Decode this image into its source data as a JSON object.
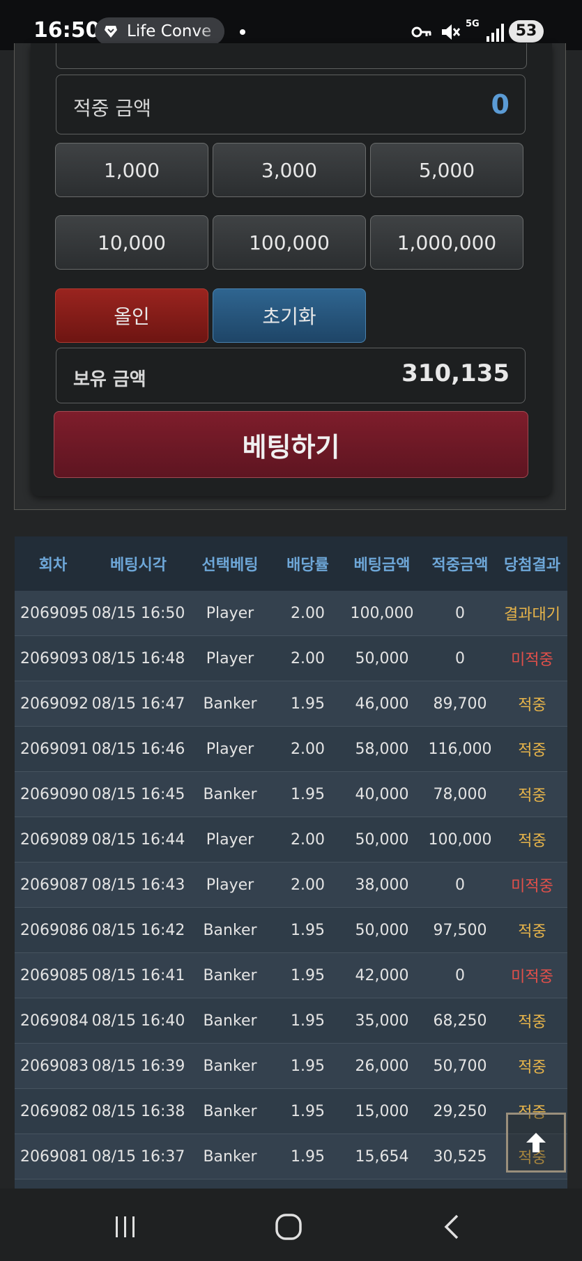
{
  "status_bar": {
    "time": "16:50",
    "app_pill": "Life Conve",
    "network": "5G",
    "battery": "53"
  },
  "bet_panel": {
    "win_amount_label": "적중 금액",
    "win_amount_value": "0",
    "chips": [
      "1,000",
      "3,000",
      "5,000",
      "10,000",
      "100,000",
      "1,000,000"
    ],
    "all_in_label": "올인",
    "reset_label": "초기화",
    "balance_label": "보유 금액",
    "balance_value": "310,135",
    "bet_button_label": "베팅하기"
  },
  "history": {
    "columns": [
      "회차",
      "베팅시각",
      "선택베팅",
      "배당률",
      "베팅금액",
      "적중금액",
      "당첨결과"
    ],
    "rows": [
      [
        "2069095",
        "08/15 16:50",
        "Player",
        "2.00",
        "100,000",
        "0",
        "결과대기"
      ],
      [
        "2069093",
        "08/15 16:48",
        "Player",
        "2.00",
        "50,000",
        "0",
        "미적중"
      ],
      [
        "2069092",
        "08/15 16:47",
        "Banker",
        "1.95",
        "46,000",
        "89,700",
        "적중"
      ],
      [
        "2069091",
        "08/15 16:46",
        "Player",
        "2.00",
        "58,000",
        "116,000",
        "적중"
      ],
      [
        "2069090",
        "08/15 16:45",
        "Banker",
        "1.95",
        "40,000",
        "78,000",
        "적중"
      ],
      [
        "2069089",
        "08/15 16:44",
        "Player",
        "2.00",
        "50,000",
        "100,000",
        "적중"
      ],
      [
        "2069087",
        "08/15 16:43",
        "Player",
        "2.00",
        "38,000",
        "0",
        "미적중"
      ],
      [
        "2069086",
        "08/15 16:42",
        "Banker",
        "1.95",
        "50,000",
        "97,500",
        "적중"
      ],
      [
        "2069085",
        "08/15 16:41",
        "Banker",
        "1.95",
        "42,000",
        "0",
        "미적중"
      ],
      [
        "2069084",
        "08/15 16:40",
        "Banker",
        "1.95",
        "35,000",
        "68,250",
        "적중"
      ],
      [
        "2069083",
        "08/15 16:39",
        "Banker",
        "1.95",
        "26,000",
        "50,700",
        "적중"
      ],
      [
        "2069082",
        "08/15 16:38",
        "Banker",
        "1.95",
        "15,000",
        "29,250",
        "적중"
      ],
      [
        "2069081",
        "08/15 16:37",
        "Banker",
        "1.95",
        "15,654",
        "30,525",
        "적중"
      ]
    ]
  },
  "colors": {
    "win": "#e8b54a",
    "lose": "#e2504a",
    "header_text": "#6ea7d8",
    "bet_button": "#7e1d2b"
  },
  "icons": [
    "brave-lion-icon",
    "key-icon",
    "mute-icon",
    "signal-icon",
    "arrow-up-icon",
    "recent-apps-icon",
    "home-icon",
    "back-icon"
  ]
}
